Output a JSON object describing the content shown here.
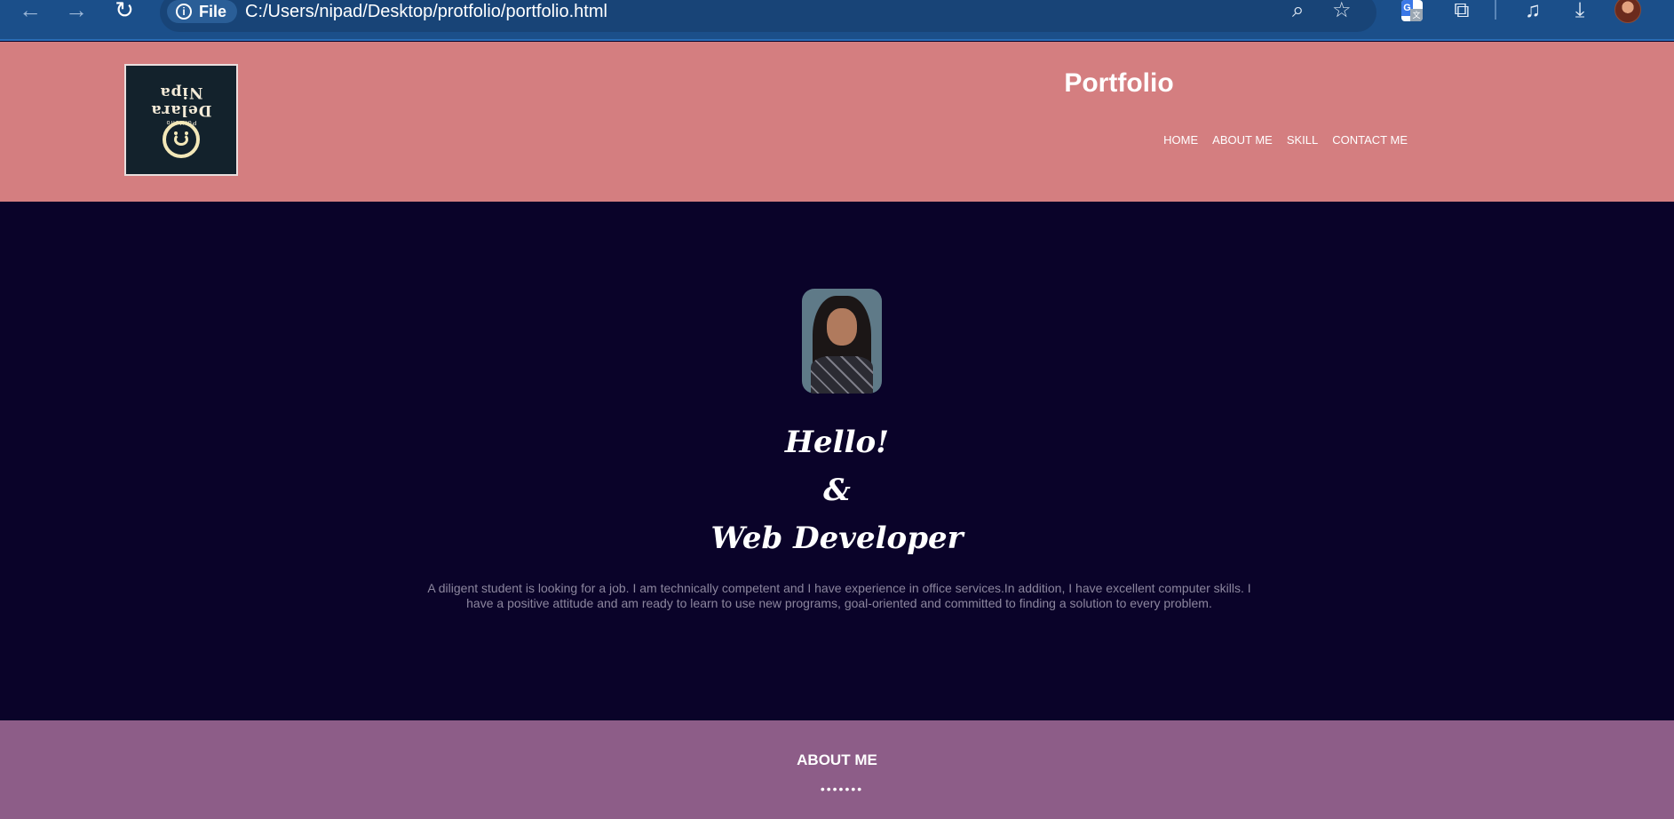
{
  "browser": {
    "nav_back": "←",
    "nav_forward": "→",
    "reload": "↻",
    "file_chip_label": "File",
    "url": "C:/Users/nipad/Desktop/protfolio/portfolio.html",
    "icons": [
      "back-icon",
      "forward-icon",
      "reload-icon",
      "info-icon",
      "zoom-icon",
      "star-icon",
      "translate-extension-icon",
      "extensions-icon",
      "media-icon",
      "download-icon",
      "profile-avatar"
    ]
  },
  "header": {
    "logo": {
      "name": "Delara Nipa",
      "subtitle": "Portfolio"
    },
    "brand": "Portfolio",
    "menu": [
      {
        "label": "HOME"
      },
      {
        "label": "ABOUT ME"
      },
      {
        "label": "SKILL"
      },
      {
        "label": "CONTACT ME"
      }
    ],
    "background": "#d47e80"
  },
  "hero": {
    "title_lines": [
      "Hello!",
      "&",
      "Web Developer"
    ],
    "description": "A diligent student is looking for a job. I am technically competent and I have experience in office services.In addition, I have excellent computer skills. I have a positive attitude and am ready to learn to use new programs, goal-oriented and committed to finding a solution to every problem.",
    "background": "#0a0329"
  },
  "about": {
    "title": "ABOUT ME",
    "divider": "•••••••",
    "background": "#8d5d88"
  }
}
